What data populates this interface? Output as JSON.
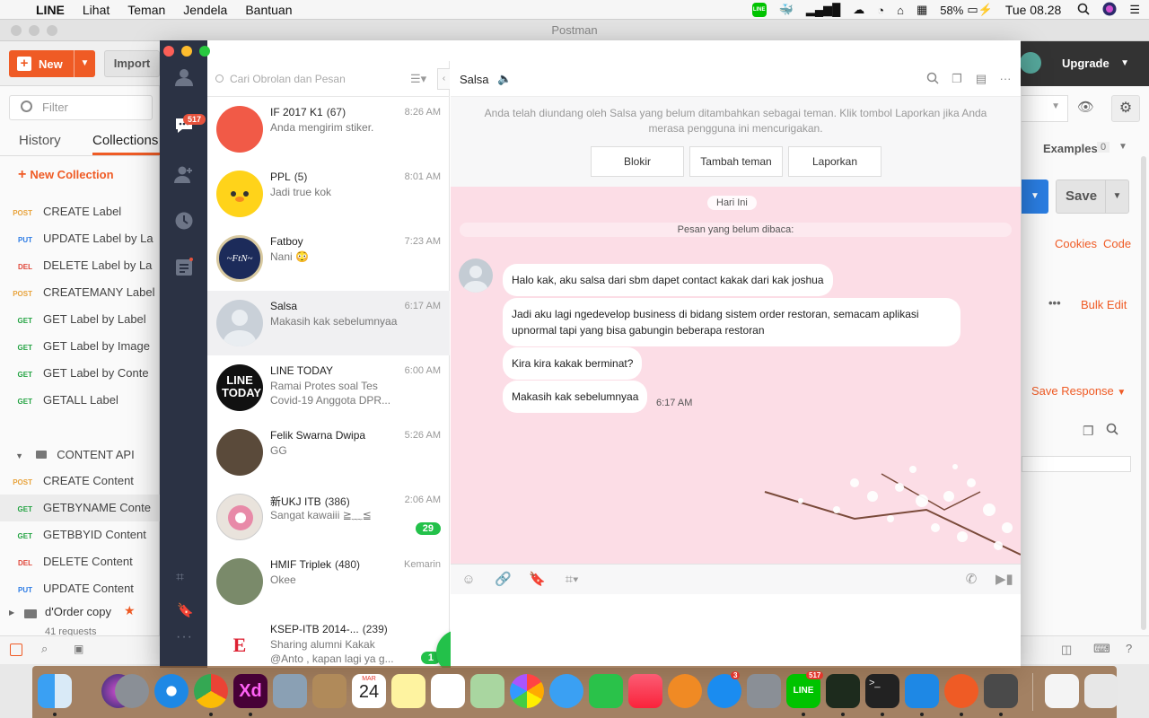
{
  "menubar": {
    "app_name": "LINE",
    "items": [
      "Lihat",
      "Teman",
      "Jendela",
      "Bantuan"
    ],
    "battery": "58%",
    "clock": "Tue 08.28"
  },
  "postman": {
    "window_title": "Postman",
    "new_label": "New",
    "import_label": "Import",
    "upgrade_label": "Upgrade",
    "filter_placeholder": "Filter",
    "tabs": [
      "History",
      "Collections"
    ],
    "new_collection": "New Collection",
    "requests": [
      {
        "method": "POST",
        "name": "CREATE Label"
      },
      {
        "method": "PUT",
        "name": "UPDATE Label by La"
      },
      {
        "method": "DEL",
        "name": "DELETE Label by La"
      },
      {
        "method": "POST",
        "name": "CREATEMANY Label"
      },
      {
        "method": "GET",
        "name": "GET Label by Label"
      },
      {
        "method": "GET",
        "name": "GET Label by Image"
      },
      {
        "method": "GET",
        "name": "GET Label by Conte"
      },
      {
        "method": "GET",
        "name": "GETALL Label"
      }
    ],
    "folder": "CONTENT API",
    "folder_requests": [
      {
        "method": "POST",
        "name": "CREATE Content"
      },
      {
        "method": "GET",
        "name": "GETBYNAME Conte"
      },
      {
        "method": "GET",
        "name": "GETBBYID Content"
      },
      {
        "method": "DEL",
        "name": "DELETE Content"
      },
      {
        "method": "PUT",
        "name": "UPDATE Content"
      }
    ],
    "collection2_name": "d'Order copy",
    "collection2_count": "41 requests",
    "examples_label": "Examples",
    "examples_count": "0",
    "save_label": "Save",
    "cookies_label": "Cookies",
    "code_label": "Code",
    "bulk_edit_label": "Bulk Edit",
    "save_response_label": "Save Response"
  },
  "line": {
    "nav_badge": "517",
    "search_placeholder": "Cari Obrolan dan Pesan",
    "chats": [
      {
        "name": "IF 2017 K1",
        "count": "(67)",
        "time": "8:26 AM",
        "preview": "Anda mengirim stiker.",
        "avatar_color": "#f15a47",
        "unread": ""
      },
      {
        "name": "PPL",
        "count": "(5)",
        "time": "8:01 AM",
        "preview": "Jadi true kok",
        "avatar_color": "#ffd31a",
        "unread": ""
      },
      {
        "name": "Fatboy",
        "count": "",
        "time": "7:23 AM",
        "preview": "Nani 😳",
        "avatar_color": "#1c2b5a",
        "unread": ""
      },
      {
        "name": "Salsa",
        "count": "",
        "time": "6:17 AM",
        "preview": "Makasih kak sebelumnyaa",
        "avatar_color": "#c9d0d8",
        "unread": ""
      },
      {
        "name": "LINE TODAY",
        "count": "",
        "time": "6:00 AM",
        "preview": "Ramai Protes soal Tes Covid-19 Anggota DPR...",
        "avatar_color": "#111111",
        "unread": ""
      },
      {
        "name": "Felik Swarna Dwipa",
        "count": "",
        "time": "5:26 AM",
        "preview": "GG",
        "avatar_color": "#5a4a3a",
        "unread": ""
      },
      {
        "name": "新UKJ ITB",
        "count": "(386)",
        "time": "2:06 AM",
        "preview": "Sangat kawaiii ≧﹏≦",
        "avatar_color": "#e9e3dc",
        "unread": "29"
      },
      {
        "name": "HMIF Triplek",
        "count": "(480)",
        "time": "Kemarin",
        "preview": "Okee",
        "avatar_color": "#7a8a6a",
        "unread": ""
      },
      {
        "name": "KSEP-ITB 2014-...",
        "count": "(239)",
        "time": "",
        "preview": "Sharing alumni Kakak @Anto , kapan lagi ya g...",
        "avatar_color": "#ffffff",
        "unread": "1"
      }
    ],
    "fatboy_avatar_text": "~FtN~",
    "linetoday_avatar_text": "LINE TODAY",
    "chat": {
      "name": "Salsa",
      "notice": "Anda telah diundang oleh Salsa yang belum ditambahkan sebagai teman. Klik tombol Laporkan jika Anda merasa pengguna ini mencurigakan.",
      "buttons": [
        "Blokir",
        "Tambah teman",
        "Laporkan"
      ],
      "date_divider": "Hari Ini",
      "unread_divider": "Pesan yang belum dibaca:",
      "messages": [
        "Halo kak, aku salsa dari sbm dapet contact kakak dari kak joshua",
        "Jadi aku lagi ngedevelop business di bidang sistem order restoran, semacam aplikasi upnormal tapi yang bisa gabungin beberapa restoran",
        "Kira kira kakak berminat?",
        "Makasih kak sebelumnyaa"
      ],
      "last_time": "6:17 AM"
    }
  },
  "dock": {
    "calendar_month": "MAR",
    "calendar_day": "24",
    "appstore_badge": "3",
    "line_badge": "517",
    "line_label": "LINE"
  }
}
